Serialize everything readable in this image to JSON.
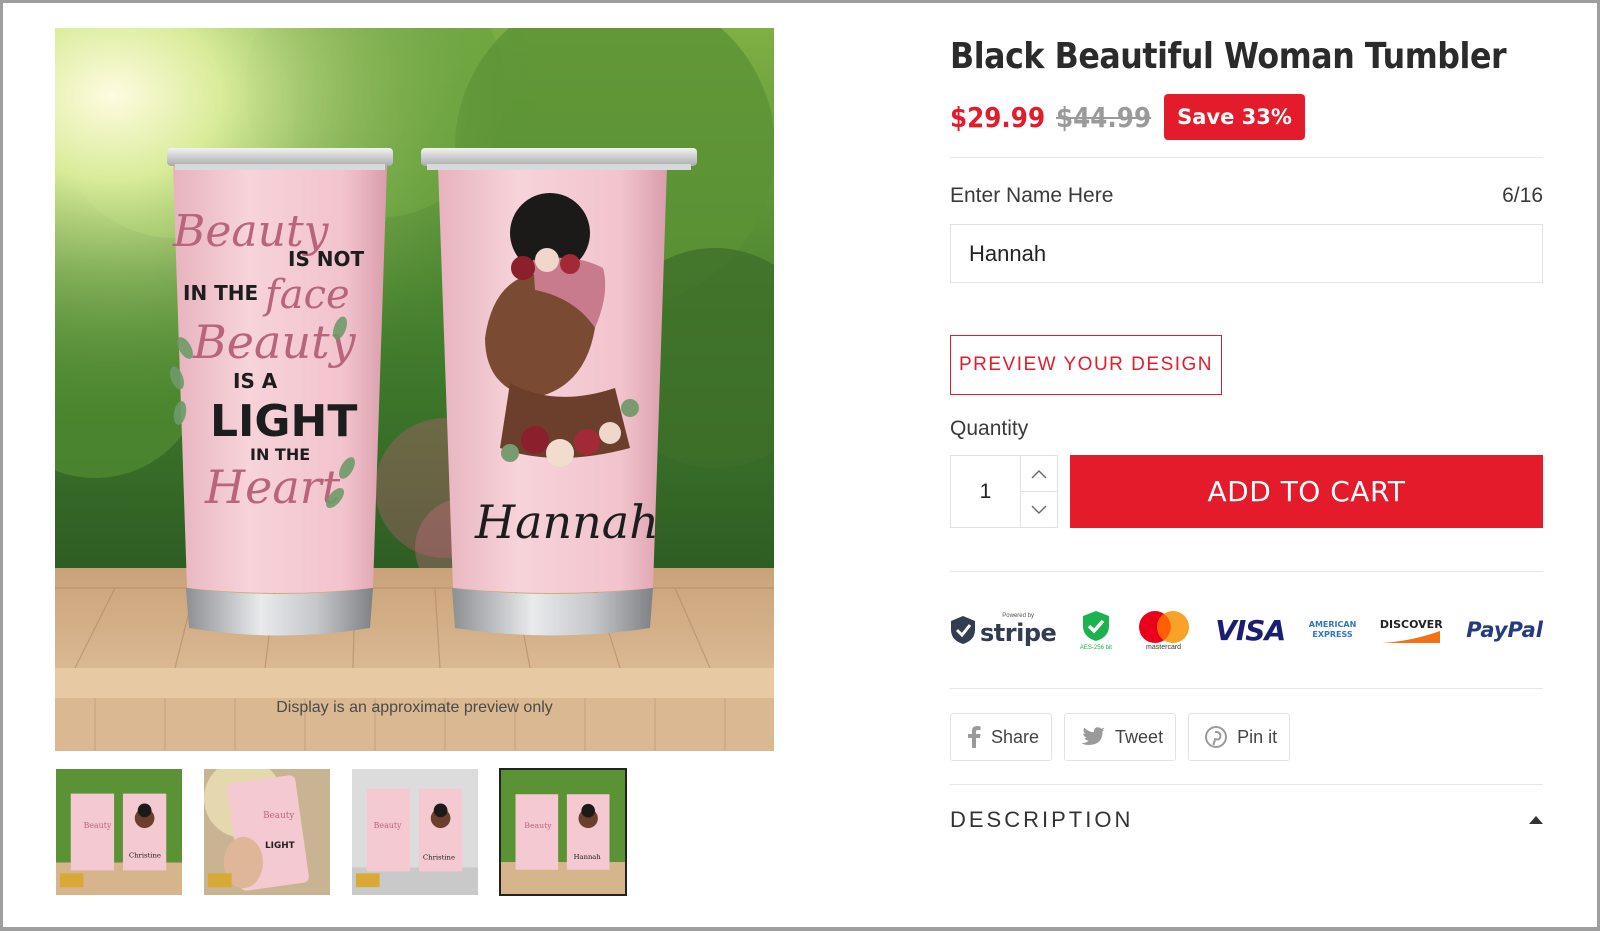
{
  "product": {
    "title": "Black Beautiful Woman Tumbler",
    "price": "$29.99",
    "compare_price": "$44.99",
    "save_badge": "Save 33%"
  },
  "gallery": {
    "preview_note": "Display is an approximate preview only",
    "left_tumbler_text": [
      "Beauty",
      "IS NOT",
      "IN THE",
      "face",
      "Beauty",
      "IS A",
      "LIGHT",
      "IN THE",
      "Heart"
    ],
    "personalized_name": "Hannah",
    "thumbnails": [
      {
        "name": "Christine",
        "active": false
      },
      {
        "name": "",
        "active": false
      },
      {
        "name": "Christine",
        "active": false
      },
      {
        "name": "Hannah",
        "active": true
      }
    ]
  },
  "personalization": {
    "field_label": "Enter Name Here",
    "char_count": "6/16",
    "value": "Hannah",
    "preview_button": "PREVIEW YOUR DESIGN"
  },
  "purchase": {
    "quantity_label": "Quantity",
    "quantity": "1",
    "add_to_cart": "ADD TO CART"
  },
  "payments": {
    "stripe_caption": "Powered by",
    "stripe": "stripe",
    "aes_caption": "AES-256 bit",
    "mastercard_caption": "mastercard",
    "visa": "VISA",
    "amex_line1": "AMERICAN",
    "amex_line2": "EXPRESS",
    "discover": "DISCOVER",
    "paypal": "PayPal"
  },
  "share": {
    "facebook": "Share",
    "twitter": "Tweet",
    "pinterest": "Pin it"
  },
  "description": {
    "label": "DESCRIPTION"
  },
  "colors": {
    "accent": "#e31b2a",
    "tumbler_pink": "#f3c6cf",
    "headwrap": "#c77b8c"
  }
}
